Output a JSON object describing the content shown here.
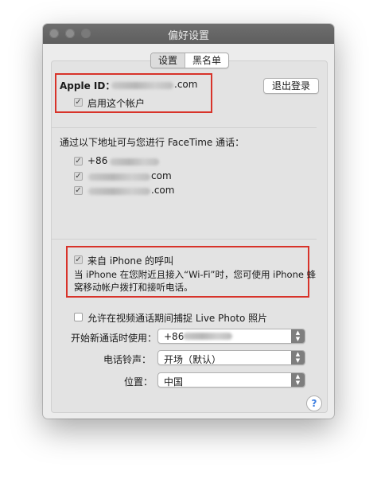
{
  "window": {
    "title": "偏好设置"
  },
  "tabs": [
    {
      "label": "设置",
      "selected": true
    },
    {
      "label": "黑名单",
      "selected": false
    }
  ],
  "account": {
    "label": "Apple ID：",
    "email_suffix": ".com",
    "enable_label": "启用这个帐户",
    "enable_checked": true,
    "sign_out_label": "退出登录"
  },
  "reach": {
    "heading": "通过以下地址可与您进行 FaceTime 通话：",
    "items": [
      {
        "text": "+86",
        "checked": true
      },
      {
        "text": "com",
        "checked": true
      },
      {
        "text": ".com",
        "checked": true
      }
    ]
  },
  "iphone_calls": {
    "label": "来自 iPhone 的呼叫",
    "checked": true,
    "description_line1": "当 iPhone 在您附近且接入“Wi-Fi”时，您可使用 iPhone 蜂",
    "description_line2": "窝移动帐户拨打和接听电话。"
  },
  "live_photo": {
    "label": "允许在视频通话期间捕捉 Live Photo 照片",
    "checked": false
  },
  "settings": {
    "start_calls_label": "开始新通话时使用：",
    "start_calls_value": "+86",
    "ringtone_label": "电话铃声：",
    "ringtone_value": "开场（默认）",
    "location_label": "位置：",
    "location_value": "中国"
  },
  "help": {
    "label": "?"
  },
  "colors": {
    "highlight": "#d8332a",
    "titlebar": "#666666",
    "window_bg": "#ececec",
    "help_accent": "#3b7de0"
  }
}
